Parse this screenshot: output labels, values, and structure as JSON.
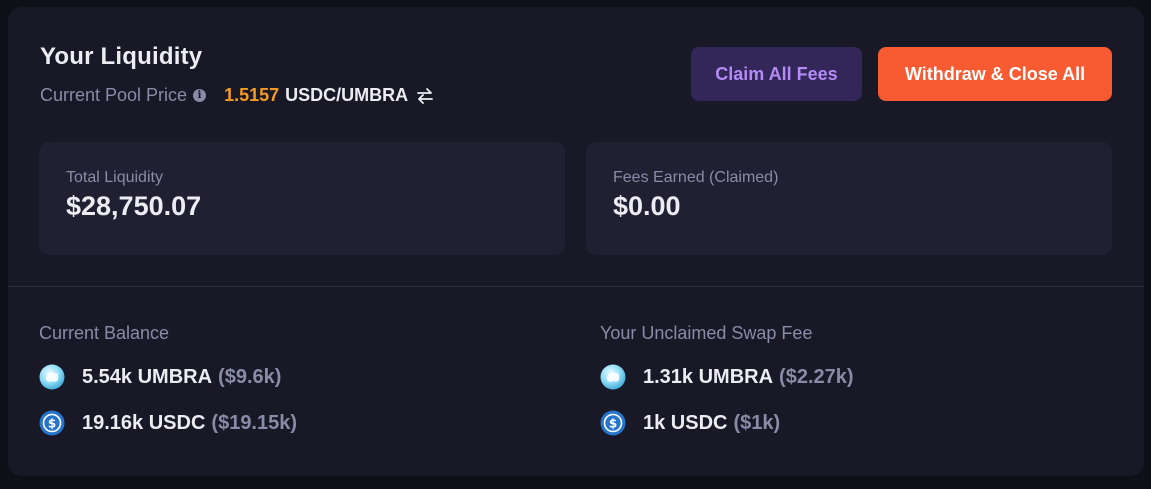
{
  "header": {
    "title": "Your Liquidity",
    "pool_price_label": "Current Pool Price",
    "pool_price_value": "1.5157",
    "pool_price_pair": "USDC/UMBRA"
  },
  "buttons": {
    "claim_label": "Claim All Fees",
    "withdraw_label": "Withdraw & Close All"
  },
  "stats": {
    "total_liquidity_label": "Total Liquidity",
    "total_liquidity_value": "$28,750.07",
    "fees_earned_label": "Fees Earned (Claimed)",
    "fees_earned_value": "$0.00"
  },
  "current_balance": {
    "title": "Current Balance",
    "items": [
      {
        "icon": "umbra-token-icon",
        "amount": "5.54k UMBRA",
        "usd": "($9.6k)"
      },
      {
        "icon": "usdc-token-icon",
        "amount": "19.16k USDC",
        "usd": "($19.15k)"
      }
    ]
  },
  "unclaimed_fee": {
    "title": "Your Unclaimed Swap Fee",
    "items": [
      {
        "icon": "umbra-token-icon",
        "amount": "1.31k UMBRA",
        "usd": "($2.27k)"
      },
      {
        "icon": "usdc-token-icon",
        "amount": "1k USDC",
        "usd": "($1k)"
      }
    ]
  },
  "colors": {
    "background": "#181827",
    "panel": "#202032",
    "accent_orange": "#f59a25",
    "withdraw_button": "#f85a32",
    "claim_button": "#33275a",
    "claim_text": "#b48bf5",
    "muted_text": "#8a8ba6"
  }
}
